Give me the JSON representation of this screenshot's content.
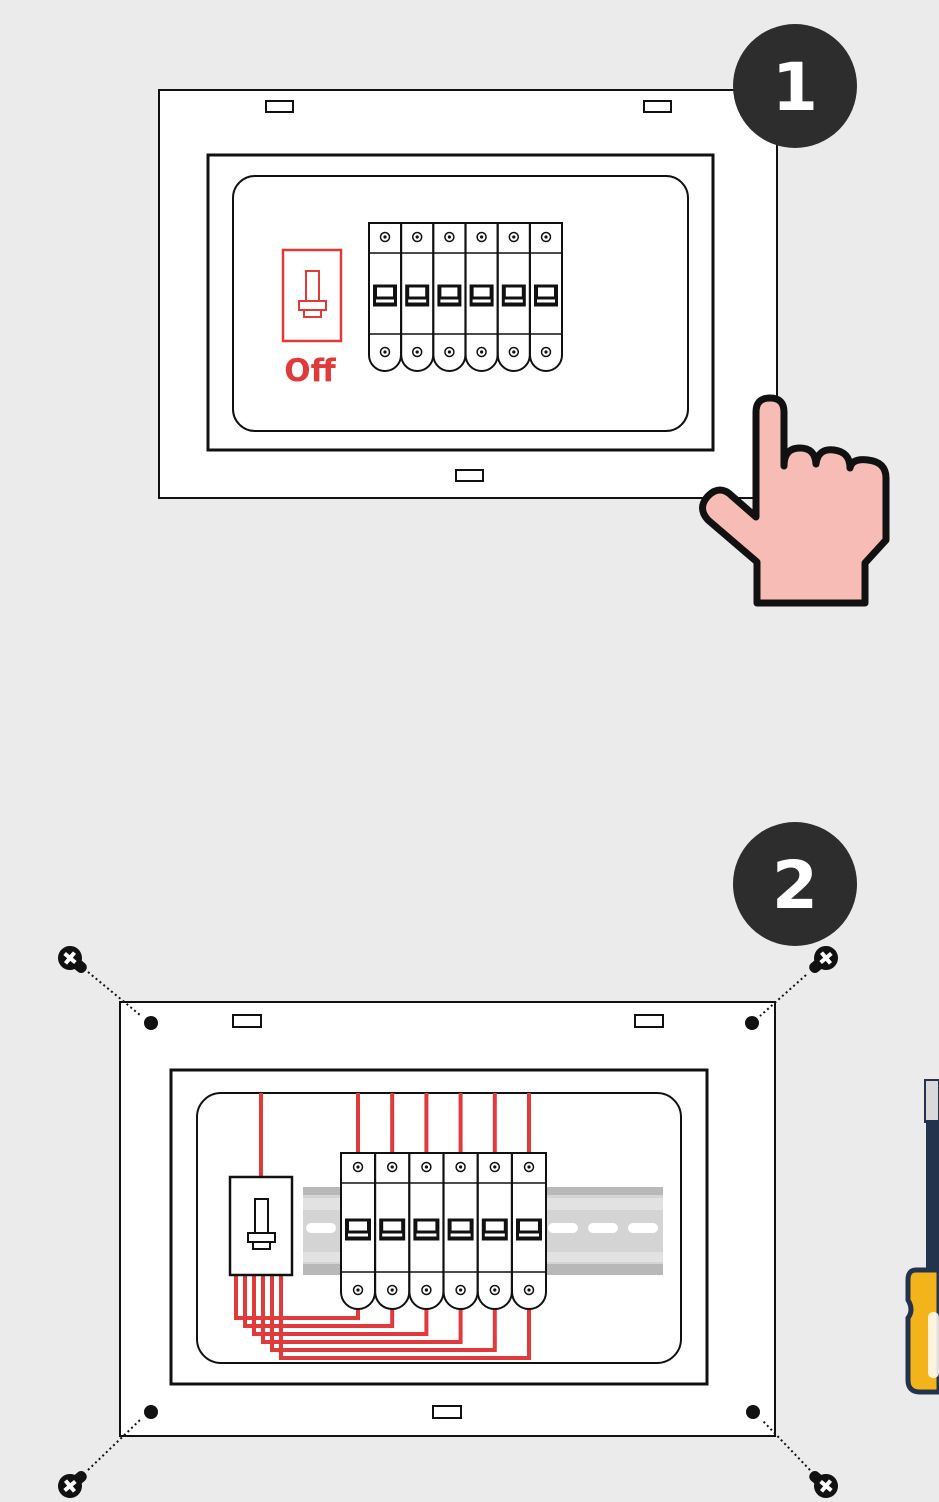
{
  "steps": [
    {
      "number": "1",
      "main_switch_state": "Off",
      "breaker_count": 6
    },
    {
      "number": "2",
      "breaker_count": 6,
      "screw_count": 4
    }
  ],
  "colors": {
    "background": "#ebebeb",
    "badge": "#2d2d2d",
    "accent_red": "#e03a3a",
    "hand_fill": "#f7bcb6",
    "outline": "#111111",
    "rail": "#c9c9c9",
    "screwdriver_shaft": "#23334d",
    "screwdriver_handle": "#f3b41b",
    "screwdriver_handle_dark": "#23334d"
  },
  "icons": {
    "pointer": "hand-pointer-icon",
    "screw": "screw-icon",
    "tool": "screwdriver-icon"
  }
}
